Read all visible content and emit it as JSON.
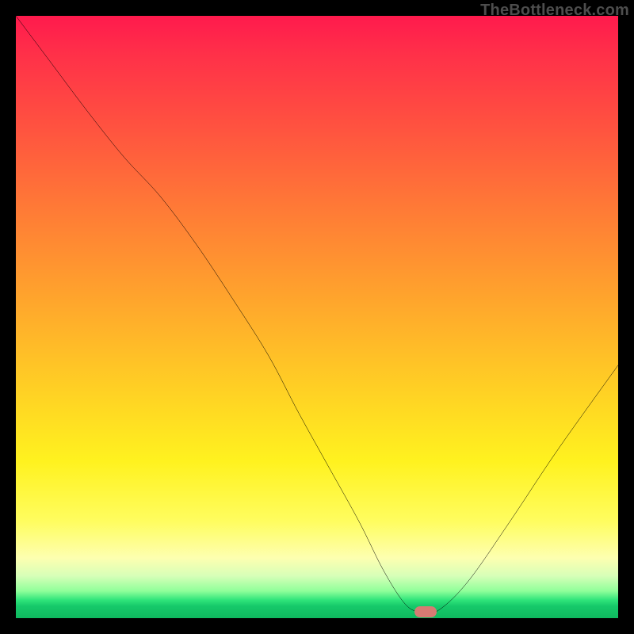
{
  "attribution": "TheBottleneck.com",
  "chart_data": {
    "type": "line",
    "title": "",
    "xlabel": "",
    "ylabel": "",
    "xlim": [
      0,
      100
    ],
    "ylim": [
      0,
      100
    ],
    "grid": false,
    "legend": false,
    "series": [
      {
        "name": "bottleneck-curve",
        "x": [
          0,
          6,
          12,
          18,
          24,
          30,
          36,
          42,
          47,
          52,
          57,
          61,
          64.5,
          67,
          70,
          75,
          82,
          90,
          100
        ],
        "y": [
          100,
          92,
          84,
          76.5,
          70,
          62,
          53,
          43.5,
          34,
          25,
          16,
          8,
          2.5,
          1,
          1.2,
          6,
          16,
          28,
          42
        ]
      }
    ],
    "marker": {
      "x": 68,
      "y": 1
    },
    "background_gradient": {
      "stops": [
        {
          "pct": 0,
          "color": "#ff1a4d"
        },
        {
          "pct": 18,
          "color": "#ff5140"
        },
        {
          "pct": 46,
          "color": "#ffa22d"
        },
        {
          "pct": 74,
          "color": "#fff21f"
        },
        {
          "pct": 90,
          "color": "#fdffb0"
        },
        {
          "pct": 97,
          "color": "#16c96a"
        },
        {
          "pct": 100,
          "color": "#0fb95f"
        }
      ]
    }
  }
}
